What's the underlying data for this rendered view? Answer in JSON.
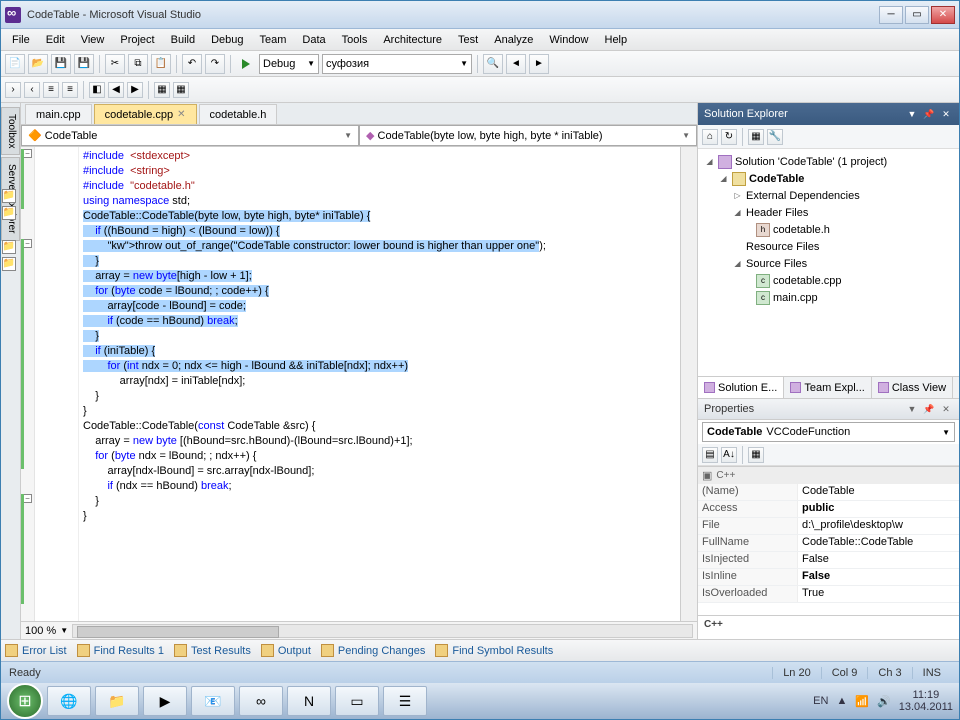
{
  "title": "CodeTable - Microsoft Visual Studio",
  "menus": [
    "File",
    "Edit",
    "View",
    "Project",
    "Build",
    "Debug",
    "Team",
    "Data",
    "Tools",
    "Architecture",
    "Test",
    "Analyze",
    "Window",
    "Help"
  ],
  "config": "Debug",
  "platform": "суфозия",
  "tabs": [
    {
      "label": "main.cpp",
      "active": false
    },
    {
      "label": "codetable.cpp",
      "active": true
    },
    {
      "label": "codetable.h",
      "active": false
    }
  ],
  "scope_left": "CodeTable",
  "scope_right": "CodeTable(byte low, byte high, byte * iniTable)",
  "zoom": "100 %",
  "code_lines": [
    {
      "t": "#include <stdexcept>",
      "cls": "pre",
      "sel": false
    },
    {
      "t": "#include <string>",
      "cls": "pre",
      "sel": false
    },
    {
      "t": "#include \"codetable.h\"",
      "cls": "pre2",
      "sel": false
    },
    {
      "t": "",
      "sel": false
    },
    {
      "t": "using namespace std;",
      "cls": "kw",
      "sel": false
    },
    {
      "t": "",
      "sel": false
    },
    {
      "t": "CodeTable::CodeTable(byte low, byte high, byte* iniTable) {",
      "sel": true
    },
    {
      "t": "    if ((hBound = high) < (lBound = low)) {",
      "cls": "kw2",
      "sel": true
    },
    {
      "t": "        throw out_of_range(\"CodeTable constructor: lower bound is higher than upper one\");",
      "cls": "throw",
      "sel": true
    },
    {
      "t": "    }",
      "sel": true
    },
    {
      "t": "",
      "sel": true
    },
    {
      "t": "    array = new byte[high - low + 1];",
      "cls": "kw2",
      "sel": true
    },
    {
      "t": "    for (byte code = lBound; ; code++) {",
      "cls": "kw2",
      "sel": true
    },
    {
      "t": "        array[code - lBound] = code;",
      "sel": true
    },
    {
      "t": "        if (code == hBound) break;",
      "cls": "kw2",
      "sel": true
    },
    {
      "t": "    }",
      "sel": true
    },
    {
      "t": "",
      "sel": true
    },
    {
      "t": "    if (iniTable) {",
      "cls": "kw2",
      "sel": true
    },
    {
      "t": "        for (int ndx = 0; ndx <= high - lBound && iniTable[ndx]; ndx++)",
      "cls": "kw2",
      "sel": true
    },
    {
      "t": "            array[ndx] = iniTable[ndx];",
      "sel": false
    },
    {
      "t": "    }",
      "sel": false
    },
    {
      "t": "}",
      "sel": false
    },
    {
      "t": "",
      "sel": false
    },
    {
      "t": "CodeTable::CodeTable(const CodeTable &src) {",
      "cls": "kw2",
      "sel": false
    },
    {
      "t": "    array = new byte [(hBound=src.hBound)-(lBound=src.lBound)+1];",
      "cls": "kw2",
      "sel": false
    },
    {
      "t": "",
      "sel": false
    },
    {
      "t": "    for (byte ndx = lBound; ; ndx++) {",
      "cls": "kw2",
      "sel": false
    },
    {
      "t": "        array[ndx-lBound] = src.array[ndx-lBound];",
      "sel": false
    },
    {
      "t": "        if (ndx == hBound) break;",
      "cls": "kw2",
      "sel": false
    },
    {
      "t": "    }",
      "sel": false
    },
    {
      "t": "}",
      "sel": false
    }
  ],
  "solution_explorer": {
    "title": "Solution Explorer",
    "root": "Solution 'CodeTable' (1 project)",
    "project": "CodeTable",
    "folders": [
      {
        "name": "External Dependencies",
        "exp": "▷",
        "children": []
      },
      {
        "name": "Header Files",
        "exp": "◢",
        "children": [
          {
            "name": "codetable.h",
            "type": "h"
          }
        ]
      },
      {
        "name": "Resource Files",
        "exp": "",
        "children": []
      },
      {
        "name": "Source Files",
        "exp": "◢",
        "children": [
          {
            "name": "codetable.cpp",
            "type": "cpp"
          },
          {
            "name": "main.cpp",
            "type": "cpp"
          }
        ]
      }
    ]
  },
  "se_tabs": [
    {
      "label": "Solution E...",
      "active": true
    },
    {
      "label": "Team Expl...",
      "active": false
    },
    {
      "label": "Class View",
      "active": false
    }
  ],
  "properties": {
    "title": "Properties",
    "object": "CodeTable",
    "type": "VCCodeFunction",
    "category": "C++",
    "rows": [
      {
        "name": "(Name)",
        "value": "CodeTable",
        "bold": false
      },
      {
        "name": "Access",
        "value": "public",
        "bold": true
      },
      {
        "name": "File",
        "value": "d:\\_profile\\desktop\\w",
        "bold": false
      },
      {
        "name": "FullName",
        "value": "CodeTable::CodeTable",
        "bold": false
      },
      {
        "name": "IsInjected",
        "value": "False",
        "bold": false
      },
      {
        "name": "IsInline",
        "value": "False",
        "bold": true
      },
      {
        "name": "IsOverloaded",
        "value": "True",
        "bold": false
      }
    ],
    "descTitle": "C++"
  },
  "bottom_tabs": [
    "Error List",
    "Find Results 1",
    "Test Results",
    "Output",
    "Pending Changes",
    "Find Symbol Results"
  ],
  "status": {
    "ready": "Ready",
    "ln": "Ln 20",
    "col": "Col 9",
    "ch": "Ch 3",
    "ins": "INS"
  },
  "tray": {
    "lang": "EN",
    "net": "",
    "time": "11:19",
    "date": "13.04.2011"
  }
}
